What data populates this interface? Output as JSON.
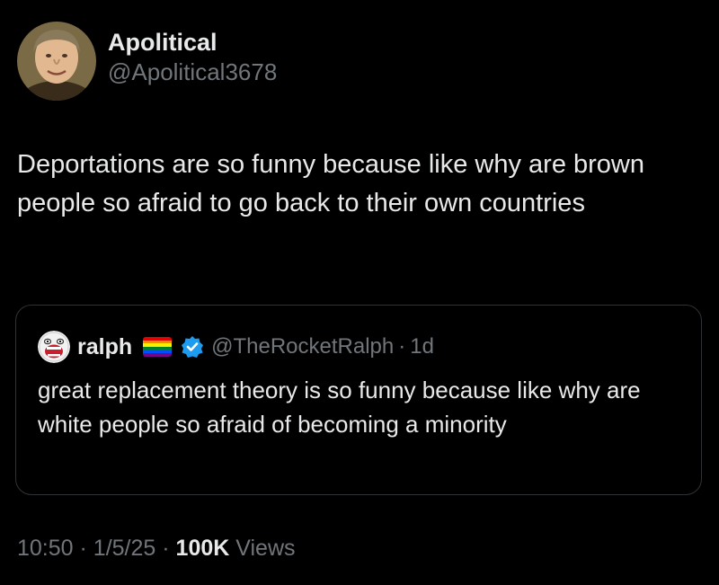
{
  "tweet": {
    "author": {
      "name": "Apolitical",
      "handle": "@Apolitical3678"
    },
    "text": "Deportations are so funny because like why are brown people so afraid to go back to their own countries",
    "quoted": {
      "name": "ralph",
      "name_suffix_icon": "rainbow-flag-icon",
      "verified_icon": "verified-badge-icon",
      "handle": "@TheRocketRalph",
      "separator": "·",
      "time": "1d",
      "text": "great replacement theory is so funny because like why are white people so afraid of becoming a minority"
    },
    "meta": {
      "time": "10:50",
      "separator1": "·",
      "date": "1/5/25",
      "separator2": "·",
      "views_count": "100K",
      "views_label": "Views"
    }
  },
  "colors": {
    "background": "#000000",
    "primary_text": "#e7e9ea",
    "secondary_text": "#71767b",
    "border": "#2f3336",
    "verified_blue": "#1d9bf0"
  },
  "flag_colors": [
    "#e40303",
    "#ff8c00",
    "#ffed00",
    "#008026",
    "#004dff",
    "#750787"
  ]
}
